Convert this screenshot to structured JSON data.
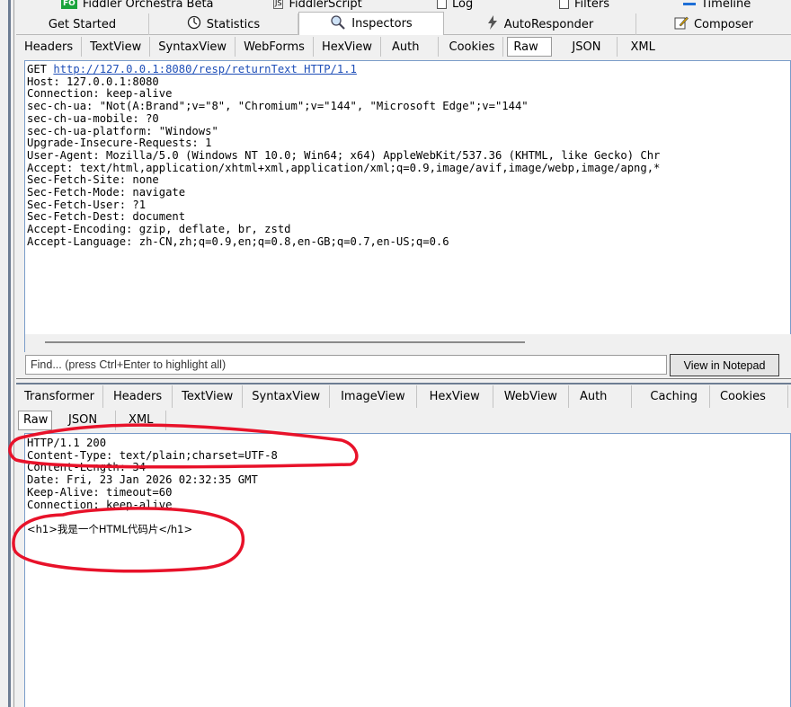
{
  "top_tabs_row1": [
    {
      "label": "Fiddler Orchestra Beta",
      "icon": "fiddler-orchestra-icon",
      "badge": "FO"
    },
    {
      "label": "FiddlerScript",
      "icon": "fiddlerscript-icon",
      "badge": "JS"
    },
    {
      "label": "Log",
      "icon": "log-icon"
    },
    {
      "label": "Filters",
      "icon": "filters-icon"
    },
    {
      "label": "Timeline",
      "icon": "timeline-icon"
    }
  ],
  "top_tabs_row2": [
    {
      "label": "Get Started",
      "icon": ""
    },
    {
      "label": "Statistics",
      "icon": "statistics-icon"
    },
    {
      "label": "Inspectors",
      "icon": "inspectors-icon",
      "active": true
    },
    {
      "label": "AutoResponder",
      "icon": "autoresponder-icon"
    },
    {
      "label": "Composer",
      "icon": "composer-icon"
    }
  ],
  "request_tabs": [
    "Headers",
    "TextView",
    "SyntaxView",
    "WebForms",
    "HexView",
    "Auth",
    "Cookies",
    "Raw",
    "JSON",
    "XML"
  ],
  "request_selected_tab": "Raw",
  "request": {
    "first_line_method": "GET ",
    "first_line_url": "http://127.0.0.1:8080/resp/returnText HTTP/1.1",
    "headers": "Host: 127.0.0.1:8080\nConnection: keep-alive\nsec-ch-ua: \"Not(A:Brand\";v=\"8\", \"Chromium\";v=\"144\", \"Microsoft Edge\";v=\"144\"\nsec-ch-ua-mobile: ?0\nsec-ch-ua-platform: \"Windows\"\nUpgrade-Insecure-Requests: 1\nUser-Agent: Mozilla/5.0 (Windows NT 10.0; Win64; x64) AppleWebKit/537.36 (KHTML, like Gecko) Chr\nAccept: text/html,application/xhtml+xml,application/xml;q=0.9,image/avif,image/webp,image/apng,*\nSec-Fetch-Site: none\nSec-Fetch-Mode: navigate\nSec-Fetch-User: ?1\nSec-Fetch-Dest: document\nAccept-Encoding: gzip, deflate, br, zstd\nAccept-Language: zh-CN,zh;q=0.9,en;q=0.8,en-GB;q=0.7,en-US;q=0.6"
  },
  "find": {
    "placeholder": "Find... (press Ctrl+Enter to highlight all)",
    "button": "View in Notepad"
  },
  "response_tabs": [
    "Transformer",
    "Headers",
    "TextView",
    "SyntaxView",
    "ImageView",
    "HexView",
    "WebView",
    "Auth",
    "Caching",
    "Cookies"
  ],
  "response_tabs_row2": [
    "Raw",
    "JSON",
    "XML"
  ],
  "response_selected_tab": "Raw",
  "response": {
    "status_line": "HTTP/1.1 200",
    "content_type": "Content-Type: text/plain;charset=UTF-8",
    "content_length": "Content-Length: 34",
    "date": "Date: Fri, 23 Jan 2026 02:32:35 GMT",
    "keep_alive": "Keep-Alive: timeout=60",
    "connection": "Connection: keep-alive",
    "body": "<h1>我是一个HTML代码片</h1>"
  },
  "colors": {
    "annotation_red": "#e8122a",
    "link_blue": "#1f4fb8",
    "pane_border": "#7a9cc9"
  }
}
